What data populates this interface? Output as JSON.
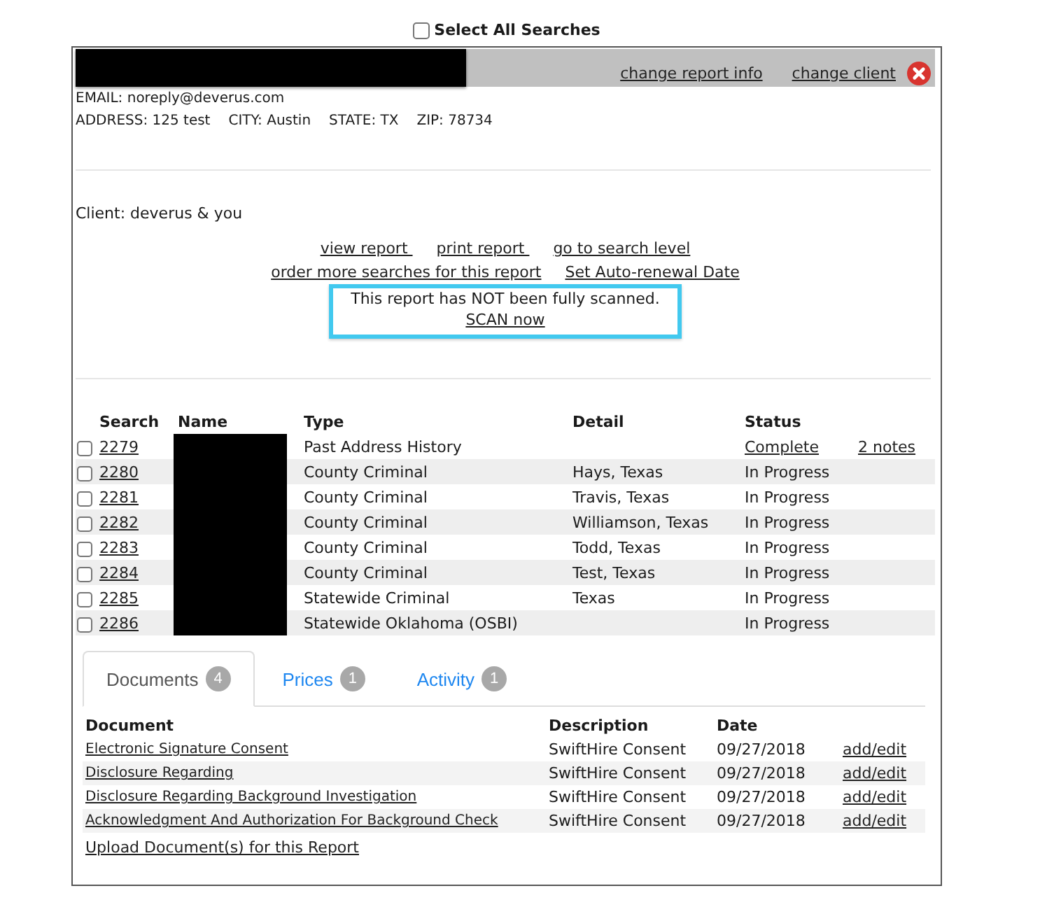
{
  "select_all": {
    "label": "Select All Searches",
    "checked": false
  },
  "header": {
    "title_redacted": true,
    "links": [
      "change report info",
      "change client"
    ]
  },
  "contact": {
    "email": "EMAIL: noreply@deverus.com",
    "address": [
      "ADDRESS: 125 test",
      "CITY: Austin",
      "STATE: TX",
      "ZIP: 78734"
    ]
  },
  "client": "Client: deverus & you",
  "actions": [
    [
      "view report ",
      "print report ",
      "go to search level"
    ],
    [
      "order more searches for this report",
      "Set Auto-renewal Date"
    ]
  ],
  "scan_notice": {
    "message": "This report has NOT been fully scanned.",
    "link": "SCAN now"
  },
  "searches": {
    "columns": [
      "Search",
      "Name",
      "Type",
      "Detail",
      "Status"
    ],
    "rows": [
      {
        "checked": false,
        "number": "2279",
        "name_redacted": true,
        "type": "Past Address History",
        "status": {
          "kind": "link",
          "text": "Complete"
        },
        "notes": "2 notes"
      },
      {
        "checked": false,
        "number": "2280",
        "name_redacted": true,
        "type": "County Criminal",
        "detail": "Hays, Texas",
        "status": {
          "kind": "text",
          "text": "In Progress"
        }
      },
      {
        "checked": false,
        "number": "2281",
        "name_redacted": true,
        "type": "County Criminal",
        "detail": "Travis, Texas",
        "status": {
          "kind": "text",
          "text": "In Progress"
        }
      },
      {
        "checked": false,
        "number": "2282",
        "name_redacted": true,
        "type": "County Criminal",
        "detail": "Williamson, Texas",
        "status": {
          "kind": "text",
          "text": "In Progress"
        }
      },
      {
        "checked": false,
        "number": "2283",
        "name_redacted": true,
        "type": "County Criminal",
        "detail": "Todd, Texas",
        "status": {
          "kind": "text",
          "text": "In Progress"
        }
      },
      {
        "checked": false,
        "number": "2284",
        "name_redacted": true,
        "type": "County Criminal",
        "detail": "Test, Texas",
        "status": {
          "kind": "text",
          "text": "In Progress"
        }
      },
      {
        "checked": false,
        "number": "2285",
        "name_redacted": true,
        "type": "Statewide Criminal",
        "detail": "Texas",
        "status": {
          "kind": "text",
          "text": "In Progress"
        }
      },
      {
        "checked": false,
        "number": "2286",
        "name_redacted": true,
        "type": "Statewide Oklahoma (OSBI)",
        "status": {
          "kind": "text",
          "text": "In Progress"
        }
      }
    ]
  },
  "tabs": [
    {
      "label": "Documents",
      "count": "4",
      "selected": true
    },
    {
      "label": "Prices",
      "count": "1",
      "selected": false
    },
    {
      "label": "Activity",
      "count": "1",
      "selected": false
    }
  ],
  "documents": {
    "columns": [
      "Document",
      "Description",
      "Date"
    ],
    "rows": [
      {
        "document": "Electronic Signature Consent",
        "description": "SwiftHire Consent",
        "date": "09/27/2018",
        "action": "add/edit"
      },
      {
        "document": "Disclosure Regarding",
        "description": "SwiftHire Consent",
        "date": "09/27/2018",
        "action": "add/edit"
      },
      {
        "document": "Disclosure Regarding Background Investigation",
        "description": "SwiftHire Consent",
        "date": "09/27/2018",
        "action": "add/edit"
      },
      {
        "document": "Acknowledgment And Authorization For Background Check",
        "description": "SwiftHire Consent",
        "date": "09/27/2018",
        "action": "add/edit"
      }
    ],
    "upload_link": "Upload Document(s) for this Report"
  }
}
